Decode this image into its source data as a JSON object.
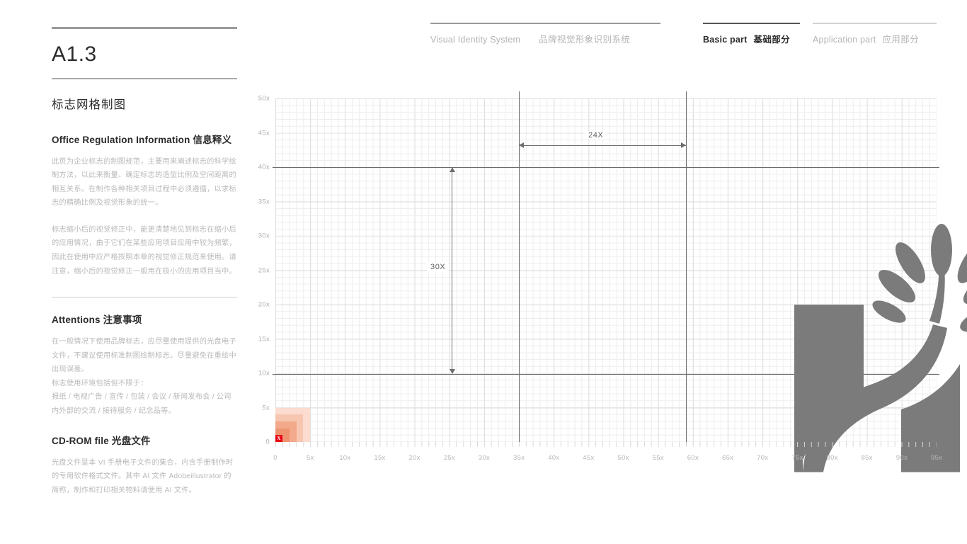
{
  "header": {
    "left_group": {
      "en": "Visual Identity System",
      "cn": "品牌视觉形象识别系统"
    },
    "basic": {
      "en": "Basic part",
      "cn": "基础部分"
    },
    "application": {
      "en": "Application part",
      "cn": "应用部分"
    }
  },
  "left": {
    "code": "A1.3",
    "section_title": "标志网格制图",
    "blocks": [
      {
        "heading": "Office Regulation Information 信息释义",
        "paragraphs": [
          "此页为企业标志的制图规范，主要用来阐述标志的科学绘制方法，以此来衡量、确定标志的造型比例及空间距离的相互关系。在制作各种相关项目过程中必须遵循，以求标志的精确比例及视觉形象的统一。",
          "标志缩小后的视觉修正中，能更清楚地见到标志在缩小后的应用情况，由于它们在某些应用项目应用中较为频繁，因此在使用中应严格按照本章的视觉修正规范来使用。请注意，缩小后的视觉修正一般用在极小的应用项目当中。"
        ]
      },
      {
        "heading": "Attentions 注意事项",
        "paragraphs": [
          "在一般情况下使用品牌标志，应尽量使用提供的光盘电子文件，不建议使用标准制图绘制标志。尽量避免在重绘中出现误差。",
          "标志使用环境包括但不限于：",
          "报纸 / 电视广告 / 宣传 / 包装 / 会议 / 新闻发布会 / 公司内外部的交流 / 接待服务 / 纪念品等。"
        ]
      },
      {
        "heading": "CD-ROM file 光盘文件",
        "paragraphs": [
          "光盘文件是本 VI 手册电子文件的集合，内含手册制作时的专用软件格式文件。其中 AI 文件 Adobeillustrator 的简称，制作和打印相关物料请使用 AI 文件。"
        ]
      }
    ]
  },
  "chart_data": {
    "type": "scatter",
    "title": "标志网格制图",
    "xlabel": "",
    "ylabel": "",
    "xlim": [
      0,
      95
    ],
    "ylim": [
      0,
      50
    ],
    "grid": true,
    "minor_step": 1,
    "major_step": 5,
    "x_ticks": [
      "0",
      "5x",
      "10x",
      "15x",
      "20x",
      "25x",
      "30x",
      "35x",
      "40x",
      "45x",
      "50x",
      "55x",
      "60x",
      "65x",
      "70x",
      "75x",
      "80x",
      "85x",
      "90x",
      "95x"
    ],
    "y_ticks": [
      "0",
      "5x",
      "10x",
      "15x",
      "20x",
      "25x",
      "30x",
      "35x",
      "40x",
      "45x",
      "50x"
    ],
    "guides": {
      "horizontal": [
        40,
        10
      ],
      "vertical": [
        35,
        59
      ]
    },
    "annotations": [
      {
        "label": "24X",
        "orientation": "horizontal",
        "from": 35,
        "to": 59,
        "at": 42
      },
      {
        "label": "30X",
        "orientation": "vertical",
        "from": 10,
        "to": 40,
        "at": 25.3
      }
    ],
    "scale_square": {
      "steps": [
        "5x",
        "4x",
        "3x",
        "2x",
        "1x"
      ],
      "unit_label": "X",
      "colors": [
        "#fbdccf",
        "#f7c6b1",
        "#f2a98c",
        "#ee9370",
        "#e9613c"
      ],
      "unit_color": "#e60012"
    },
    "logo": {
      "name": "tree-leaf-mark",
      "color": "#7b7b7b",
      "bounds": {
        "x0": 35,
        "x1": 59,
        "y0": 10,
        "y1": 40
      }
    }
  },
  "colors": {
    "minor_grid": "#ededed",
    "major_grid": "#dedede",
    "guide": "#6b6b6b",
    "logo_gray": "#7b7b7b",
    "accent_red": "#e60012",
    "text_muted": "#b9b9b9",
    "text_dark": "#2a2a2a"
  }
}
